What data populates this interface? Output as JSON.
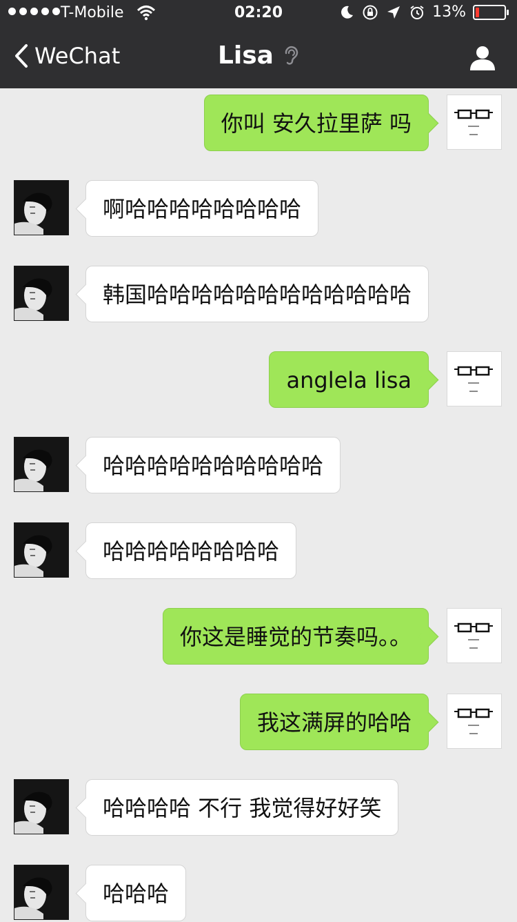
{
  "status": {
    "carrier": "T-Mobile",
    "time": "02:20",
    "battery": "13%",
    "battery_level": 0.13,
    "battery_color": "#ff3b30"
  },
  "nav": {
    "back_label": "WeChat",
    "title": "Lisa"
  },
  "theme": {
    "bar_bg": "#2f2f31",
    "chat_bg": "#ebebeb",
    "outgoing_bubble": "#9fe658",
    "incoming_bubble": "#ffffff"
  },
  "messages": [
    {
      "side": "right",
      "text": "你叫 安久拉里萨 吗"
    },
    {
      "side": "left",
      "text": "啊哈哈哈哈哈哈哈哈"
    },
    {
      "side": "left",
      "text": "韩国哈哈哈哈哈哈哈哈哈哈哈哈"
    },
    {
      "side": "right",
      "text": "anglela lisa"
    },
    {
      "side": "left",
      "text": "哈哈哈哈哈哈哈哈哈哈"
    },
    {
      "side": "left",
      "text": "哈哈哈哈哈哈哈哈"
    },
    {
      "side": "right",
      "text": "你这是睡觉的节奏吗。。"
    },
    {
      "side": "right",
      "text": "我这满屏的哈哈"
    },
    {
      "side": "left",
      "text": "哈哈哈哈 不行 我觉得好好笑"
    },
    {
      "side": "left",
      "text": "哈哈哈"
    }
  ]
}
